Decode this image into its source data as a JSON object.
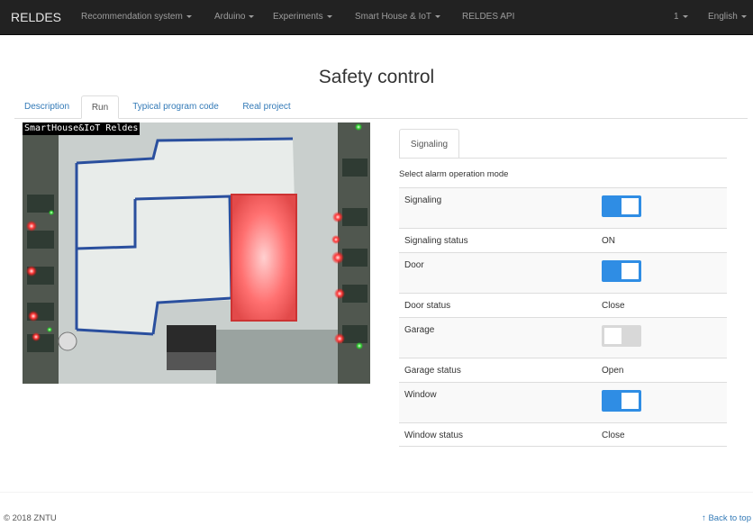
{
  "navbar": {
    "brand": "RELDES",
    "items": [
      {
        "label": "Recommendation system",
        "dropdown": true
      },
      {
        "label": "Arduino",
        "dropdown": true
      },
      {
        "label": "Experiments",
        "dropdown": true
      },
      {
        "label": "Smart House & IoT",
        "dropdown": true
      },
      {
        "label": "RELDES API",
        "dropdown": false
      }
    ],
    "user": "1",
    "language": "English"
  },
  "page": {
    "title": "Safety control"
  },
  "tabs": [
    {
      "label": "Description",
      "active": false
    },
    {
      "label": "Run",
      "active": true
    },
    {
      "label": "Typical program code",
      "active": false
    },
    {
      "label": "Real project",
      "active": false
    }
  ],
  "camera": {
    "overlay_text": "SmartHouse&IoT Reldes"
  },
  "control": {
    "tab_label": "Signaling",
    "select_label": "Select alarm operation mode",
    "rows": [
      {
        "label": "Signaling",
        "type": "toggle",
        "on": true
      },
      {
        "label": "Signaling status",
        "type": "status",
        "value": "ON"
      },
      {
        "label": "Door",
        "type": "toggle",
        "on": true
      },
      {
        "label": "Door status",
        "type": "status",
        "value": "Close"
      },
      {
        "label": "Garage",
        "type": "toggle",
        "on": false
      },
      {
        "label": "Garage status",
        "type": "status",
        "value": "Open"
      },
      {
        "label": "Window",
        "type": "toggle",
        "on": true
      },
      {
        "label": "Window status",
        "type": "status",
        "value": "Close"
      }
    ]
  },
  "colors": {
    "accent": "#2f8de4",
    "navbar": "#222222",
    "link": "#337ab7"
  },
  "footer": {
    "copyright": "© 2018 ZNTU",
    "back_to_top": "↑ Back to top"
  }
}
